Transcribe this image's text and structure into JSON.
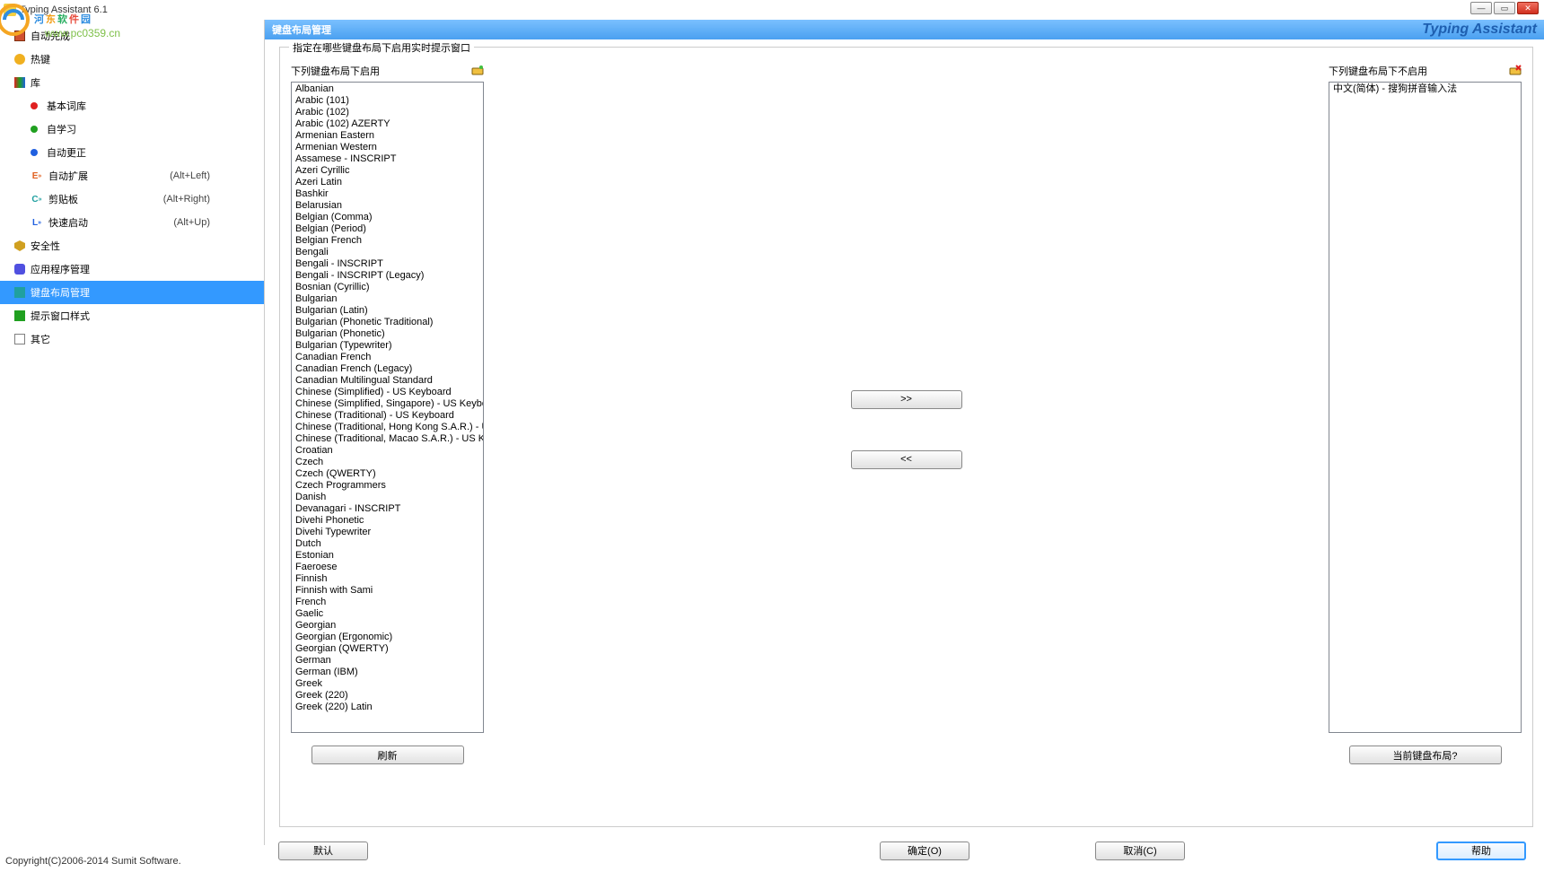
{
  "window": {
    "title": "Typing Assistant 6.1"
  },
  "watermark": {
    "line1_chars": [
      "河",
      "东",
      "软",
      "件",
      "园"
    ],
    "line2": "www.pc0359.cn"
  },
  "sidebar": {
    "items": [
      {
        "label": "自动完成",
        "icon_color": "#3399ff"
      },
      {
        "label": "热键",
        "icon_color": "#e02020"
      },
      {
        "label": "库",
        "icon_color": "#8050c0"
      }
    ],
    "lib_children": [
      {
        "label": "基本词库",
        "dot": "#e02020"
      },
      {
        "label": "自学习",
        "dot": "#20a020"
      },
      {
        "label": "自动更正",
        "dot": "#2060e0"
      },
      {
        "label": "自动扩展",
        "shortcut": "(Alt+Left)",
        "icon_prefix": "E"
      },
      {
        "label": "剪贴板",
        "shortcut": "(Alt+Right)",
        "icon_prefix": "C"
      },
      {
        "label": "快速启动",
        "shortcut": "(Alt+Up)",
        "icon_prefix": "L"
      }
    ],
    "bottom_items": [
      {
        "label": "安全性",
        "icon_color": "#d0a020"
      },
      {
        "label": "应用程序管理",
        "icon_color": "#5050e0"
      },
      {
        "label": "键盘布局管理",
        "icon_color": "#20a0a0",
        "selected": true
      },
      {
        "label": "提示窗口样式",
        "icon_color": "#20a020"
      },
      {
        "label": "其它",
        "icon_color": "#808080"
      }
    ]
  },
  "content": {
    "header_title": "键盘布局管理",
    "brand": "Typing Assistant",
    "groupbox_title": "指定在哪些键盘布局下启用实时提示窗口",
    "left_header": "下列键盘布局下启用",
    "right_header": "下列键盘布局下不启用",
    "move_right_label": ">>",
    "move_left_label": "<<",
    "refresh_label": "刷新",
    "current_layout_label": "当前键盘布局?"
  },
  "left_list": [
    "Albanian",
    "Arabic (101)",
    "Arabic (102)",
    "Arabic (102) AZERTY",
    "Armenian Eastern",
    "Armenian Western",
    "Assamese - INSCRIPT",
    "Azeri Cyrillic",
    "Azeri Latin",
    "Bashkir",
    "Belarusian",
    "Belgian (Comma)",
    "Belgian (Period)",
    "Belgian French",
    "Bengali",
    "Bengali - INSCRIPT",
    "Bengali - INSCRIPT (Legacy)",
    "Bosnian (Cyrillic)",
    "Bulgarian",
    "Bulgarian (Latin)",
    "Bulgarian (Phonetic Traditional)",
    "Bulgarian (Phonetic)",
    "Bulgarian (Typewriter)",
    "Canadian French",
    "Canadian French (Legacy)",
    "Canadian Multilingual Standard",
    "Chinese (Simplified) - US Keyboard",
    "Chinese (Simplified, Singapore) - US Keyboard",
    "Chinese (Traditional) - US Keyboard",
    "Chinese (Traditional, Hong Kong S.A.R.) - US Keyboard",
    "Chinese (Traditional, Macao S.A.R.) - US Keyboard",
    "Croatian",
    "Czech",
    "Czech (QWERTY)",
    "Czech Programmers",
    "Danish",
    "Devanagari - INSCRIPT",
    "Divehi Phonetic",
    "Divehi Typewriter",
    "Dutch",
    "Estonian",
    "Faeroese",
    "Finnish",
    "Finnish with Sami",
    "French",
    "Gaelic",
    "Georgian",
    "Georgian (Ergonomic)",
    "Georgian (QWERTY)",
    "German",
    "German (IBM)",
    "Greek",
    "Greek (220)",
    "Greek (220) Latin"
  ],
  "right_list": [
    "中文(简体) - 搜狗拼音输入法"
  ],
  "footer": {
    "default_label": "默认",
    "ok_label": "确定(O)",
    "cancel_label": "取消(C)",
    "help_label": "帮助",
    "copyright": "Copyright(C)2006-2014  Sumit Software."
  }
}
